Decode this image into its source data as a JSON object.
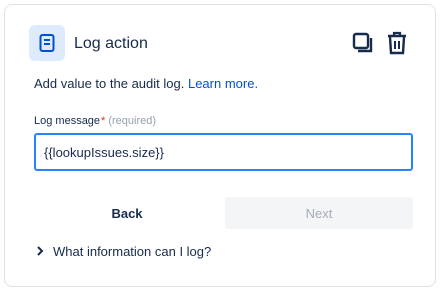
{
  "header": {
    "title": "Log action",
    "icon": "document-icon",
    "copy_icon": "copy-icon",
    "delete_icon": "trash-icon"
  },
  "description": {
    "text": "Add value to the audit log.",
    "link": "Learn more."
  },
  "log_message_field": {
    "label": "Log message",
    "required_mark": "*",
    "required_text": "(required)",
    "value": "{{lookupIssues.size}}"
  },
  "buttons": {
    "back": "Back",
    "next": "Next",
    "next_disabled": true
  },
  "expander": {
    "label": "What information can I log?",
    "expanded": false
  },
  "colors": {
    "accent": "#0052cc",
    "focus_border": "#2684ff",
    "icon_tile": "#deebff",
    "required": "#de350b"
  }
}
